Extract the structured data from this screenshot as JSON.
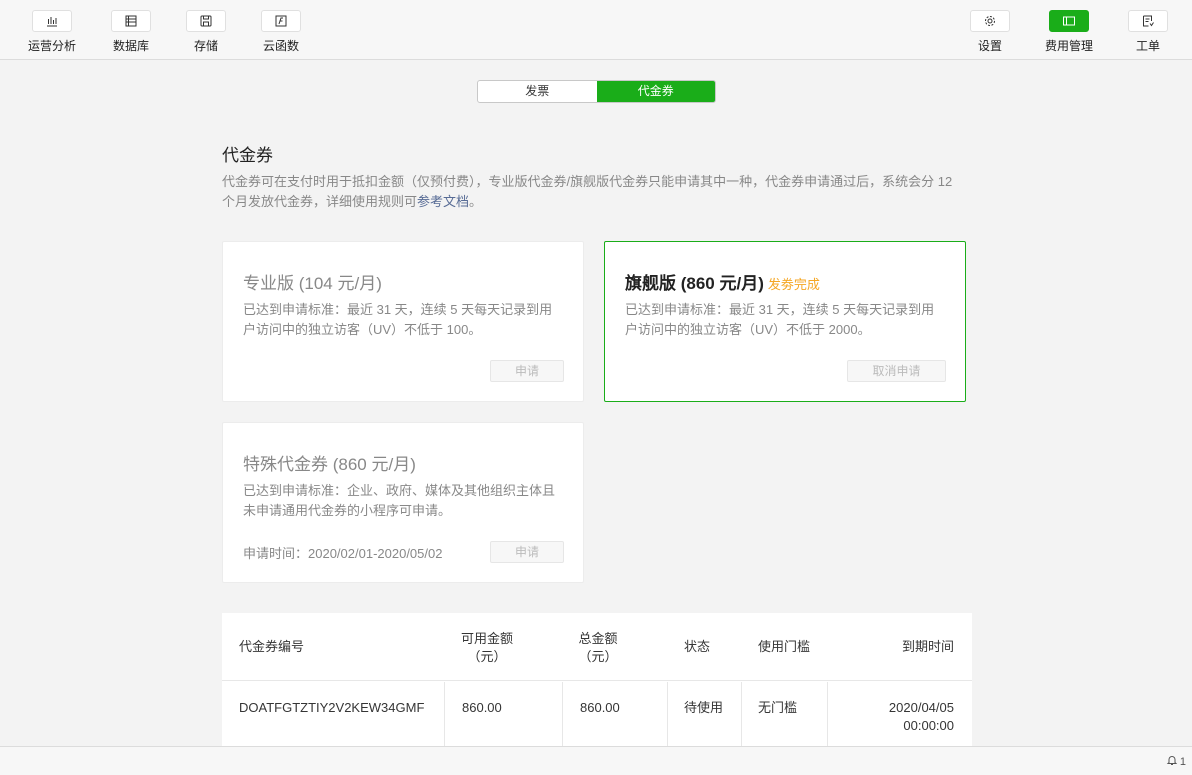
{
  "toolbar": {
    "left": [
      {
        "label": "运营分析",
        "icon": "bar-chart-icon"
      },
      {
        "label": "数据库",
        "icon": "database-icon"
      },
      {
        "label": "存储",
        "icon": "storage-icon"
      },
      {
        "label": "云函数",
        "icon": "cloud-function-icon"
      }
    ],
    "right": [
      {
        "label": "设置",
        "icon": "gear-icon"
      },
      {
        "label": "费用管理",
        "icon": "billing-icon"
      },
      {
        "label": "工单",
        "icon": "ticket-icon"
      }
    ]
  },
  "tabs": [
    {
      "label": "发票"
    },
    {
      "label": "代金券"
    }
  ],
  "section": {
    "title": "代金券",
    "desc_text": "代金券可在支付时用于抵扣金额（仅预付费），专业版代金券/旗舰版代金券只能申请其中一种，代金券申请通过后，系统会分 12 个月发放代金券，详细使用规则可",
    "desc_link": "参考文档",
    "desc_end": "。"
  },
  "cards": {
    "pro": {
      "title": "专业版 (104 元/月)",
      "desc": "已达到申请标准：最近 31 天，连续 5 天每天记录到用户访问中的独立访客（UV）不低于 100。",
      "button": "申请"
    },
    "flagship": {
      "title": "旗舰版 (860 元/月)",
      "status": "发劵完成",
      "desc": "已达到申请标准：最近 31 天，连续 5 天每天记录到用户访问中的独立访客（UV）不低于 2000。",
      "button": "取消申请"
    },
    "special": {
      "title": "特殊代金券 (860 元/月)",
      "desc": "已达到申请标准：企业、政府、媒体及其他组织主体且未申请通用代金券的小程序可申请。",
      "period": "申请时间：2020/02/01-2020/05/02",
      "button": "申请"
    }
  },
  "table": {
    "headers": {
      "id": "代金券编号",
      "available_1": "可用金额",
      "available_2": "（元）",
      "total_1": "总金额",
      "total_2": "（元）",
      "status": "状态",
      "threshold": "使用门槛",
      "expire": "到期时间"
    },
    "rows": [
      {
        "id": "DOATFGTZTIY2V2KEW34GMF",
        "available": "860.00",
        "total": "860.00",
        "status": "待使用",
        "threshold": "无门槛",
        "expire_date": "2020/04/05",
        "expire_time": "00:00:00"
      }
    ]
  },
  "statusbar": {
    "notification_count": "1"
  }
}
